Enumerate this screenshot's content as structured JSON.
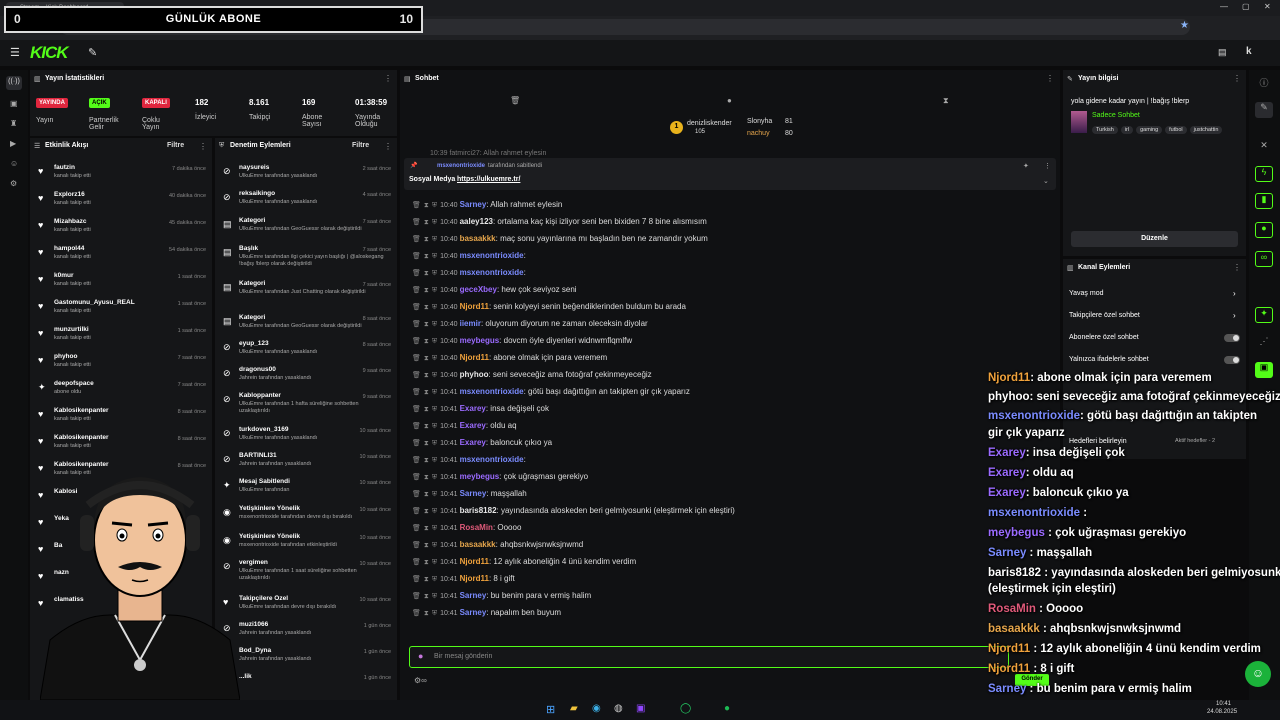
{
  "browser": {
    "tab_title": "Stream – Kick Dashboard",
    "url": "https://dashboard.kick.com/stream"
  },
  "overlay": {
    "left_count": "0",
    "label": "GÜNLÜK ABONE",
    "right_count": "10"
  },
  "logo": "KICK",
  "stats": {
    "title": "Yayın İstatistikleri",
    "yayinda_badge": "YAYINDA",
    "yayinda_label": "Yayın",
    "acik_badge": "AÇIK",
    "partner_label": "Partnerlik Gelir",
    "kapali_badge": "KAPALI",
    "coklu_label": "Çoklu Yayın",
    "viewers": "182",
    "viewers_label": "İzleyici",
    "followers": "8.161",
    "followers_label": "Takipçi",
    "subs": "169",
    "subs_label": "Abone Sayısı",
    "uptime": "01:38:59",
    "uptime_label": "Yayında Olduğu"
  },
  "activity": {
    "title": "Etkinlik Akışı",
    "filter": "Filtre",
    "items": [
      {
        "name": "fautzin",
        "desc": "kanalı takip etti",
        "time": "7 dakika önce"
      },
      {
        "name": "Explorz16",
        "desc": "kanalı takip etti",
        "time": "40 dakika önce"
      },
      {
        "name": "Mizahbazc",
        "desc": "kanalı takip etti",
        "time": "45 dakika önce"
      },
      {
        "name": "hampol44",
        "desc": "kanalı takip etti",
        "time": "54 dakika önce"
      },
      {
        "name": "k0mur",
        "desc": "kanalı takip etti",
        "time": "1 saat önce"
      },
      {
        "name": "Gastomunu_Ayusu_REAL",
        "desc": "kanalı takip etti",
        "time": "1 saat önce"
      },
      {
        "name": "munzurtilki",
        "desc": "kanalı takip etti",
        "time": "1 saat önce"
      },
      {
        "name": "phyhoo",
        "desc": "kanalı takip etti",
        "time": "7 saat önce"
      },
      {
        "name": "deepofspace",
        "desc": "abone oldu",
        "time": "7 saat önce"
      },
      {
        "name": "Kablosikenpanter",
        "desc": "kanalı takip etti",
        "time": "8 saat önce"
      },
      {
        "name": "Kablosikenpanter",
        "desc": "kanalı takip etti",
        "time": "8 saat önce"
      },
      {
        "name": "Kablosikenpanter",
        "desc": "kanalı takip etti",
        "time": "8 saat önce"
      },
      {
        "name": "Kablosi",
        "desc": "",
        "time": ""
      },
      {
        "name": "Yeka",
        "desc": "",
        "time": ""
      },
      {
        "name": "Ba",
        "desc": "",
        "time": ""
      },
      {
        "name": "nazn",
        "desc": "",
        "time": ""
      },
      {
        "name": "clamatiss",
        "desc": "",
        "time": ""
      }
    ]
  },
  "moderation": {
    "title": "Denetim Eylemleri",
    "filter": "Filtre",
    "items": [
      {
        "name": "naysureis",
        "desc": "UlkuEmre tarafından yasaklandı",
        "time": "2 saat önce"
      },
      {
        "name": "reksaikingo",
        "desc": "UlkuEmre tarafından yasaklandı",
        "time": "4 saat önce"
      },
      {
        "name": "Kategori",
        "desc": "UlkuEmre tarafından GeoGuessr olarak değiştirildi",
        "time": "7 saat önce"
      },
      {
        "name": "Başlık",
        "desc": "UlkuEmre tarafından ilgi çekici yayın başlığı | @aloskegang !bağış !blerp olarak değiştirildi",
        "time": "7 saat önce"
      },
      {
        "name": "Kategori",
        "desc": "UlkuEmre tarafından Just Chatting olarak değiştirildi",
        "time": "7 saat önce"
      },
      {
        "name": "Kategori",
        "desc": "UlkuEmre tarafından GeoGuessr olarak değiştirildi",
        "time": "8 saat önce"
      },
      {
        "name": "eyup_123",
        "desc": "UlkuEmre tarafından yasaklandı",
        "time": "8 saat önce"
      },
      {
        "name": "dragonus00",
        "desc": "Jahrein tarafından yasaklandı",
        "time": "9 saat önce"
      },
      {
        "name": "Kabloppanter",
        "desc": "UlkuEmre tarafından 1 hafta süreliğine sohbetten uzaklaştırıldı",
        "time": "9 saat önce"
      },
      {
        "name": "turkdoven_3169",
        "desc": "UlkuEmre tarafından yasaklandı",
        "time": "10 saat önce"
      },
      {
        "name": "BARTINLI31",
        "desc": "Jahrein tarafından yasaklandı",
        "time": "10 saat önce"
      },
      {
        "name": "Mesaj Sabitlendi",
        "desc": "UlkuEmre tarafından",
        "time": "10 saat önce"
      },
      {
        "name": "Yetişkinlere Yönelik",
        "desc": "msxenontrioxide tarafından devre dışı bırakıldı",
        "time": "10 saat önce"
      },
      {
        "name": "Yetişkinlere Yönelik",
        "desc": "msxenontrioxide tarafından etkinleştirildi",
        "time": "10 saat önce"
      },
      {
        "name": "vergimen",
        "desc": "UlkuEmre tarafından 1 saat süreliğine sohbetten uzaklaştırıldı",
        "time": "10 saat önce"
      },
      {
        "name": "Takipçilere Özel",
        "desc": "UlkuEmre tarafından devre dışı bırakıldı",
        "time": "10 saat önce"
      },
      {
        "name": "muzi1066",
        "desc": "Jahrein tarafından yasaklandı",
        "time": "1 gün önce"
      },
      {
        "name": "Bod_Dyna",
        "desc": "Jahrein tarafından yasaklandı",
        "time": "1 gün önce"
      },
      {
        "name": "...lik",
        "desc": "",
        "time": "1 gün önce"
      }
    ]
  },
  "chat": {
    "title": "Sohbet",
    "gift1_name": "denizliskender",
    "gift1_count": "105",
    "gift2_name": "Slonyha",
    "gift2_count": "81",
    "gift3_name": "nachuy",
    "gift3_count": "80",
    "pinned_by": "msxenontrioxide",
    "pinned_suffix": "tarafından sabitlendi",
    "pinned_text": "Sosyal Medya ",
    "pinned_link": "https://ulkuemre.tr/",
    "partial": "10:39  fatmirci27: Allah rahmet eylesin",
    "input_placeholder": "Bir mesaj gönderin",
    "send_label": "Gönder",
    "messages": [
      {
        "time": "10:40",
        "user": "Sarney",
        "color": "#7b8cff",
        "text": ": Allah rahmet eylesin"
      },
      {
        "time": "10:40",
        "user": "aaley123",
        "color": "#e8e8e8",
        "text": ": ortalama kaç kişi izliyor seni ben bixiden 7 8 bine alısmısım"
      },
      {
        "time": "10:40",
        "user": "basaakkk",
        "color": "#e6a64c",
        "text": ": maç sonu yayınlarına mı başladın ben ne zamandır yokum"
      },
      {
        "time": "10:40",
        "user": "msxenontrioxide",
        "color": "#7b8cff",
        "text": ":"
      },
      {
        "time": "10:40",
        "user": "msxenontrioxide",
        "color": "#7b8cff",
        "text": ":"
      },
      {
        "time": "10:40",
        "user": "geceXbey",
        "color": "#9b6bff",
        "text": ": hew çok seviyoz seni"
      },
      {
        "time": "10:40",
        "user": "Njord11",
        "color": "#f0a23c",
        "text": ": senin kolyeyi senin beğendiklerinden buldum bu arada"
      },
      {
        "time": "10:40",
        "user": "iiemir",
        "color": "#7b8cff",
        "text": ": oluyorum diyorum ne zaman oleceksin diyolar"
      },
      {
        "time": "10:40",
        "user": "meybegus",
        "color": "#9b6bff",
        "text": ": dovcm öyle diyenleri widnwmflqmlfw"
      },
      {
        "time": "10:40",
        "user": "Njord11",
        "color": "#f0a23c",
        "text": ": abone olmak için para veremem"
      },
      {
        "time": "10:40",
        "user": "phyhoo",
        "color": "#e8e8e8",
        "text": ": seni seveceğiz ama fotoğraf çekinmeyeceğiz"
      },
      {
        "time": "10:41",
        "user": "msxenontrioxide",
        "color": "#7b8cff",
        "text": ": götü başı dağıttığın an takipten gir çık yaparız"
      },
      {
        "time": "10:41",
        "user": "Exarey",
        "color": "#9b6bff",
        "text": ": insa değişeli çok"
      },
      {
        "time": "10:41",
        "user": "Exarey",
        "color": "#9b6bff",
        "text": ": oldu aq"
      },
      {
        "time": "10:41",
        "user": "Exarey",
        "color": "#9b6bff",
        "text": ": baloncuk çıkıo ya"
      },
      {
        "time": "10:41",
        "user": "msxenontrioxide",
        "color": "#7b8cff",
        "text": ":"
      },
      {
        "time": "10:41",
        "user": "meybegus",
        "color": "#9b6bff",
        "text": ": çok uğraşması gerekiyo"
      },
      {
        "time": "10:41",
        "user": "Sarney",
        "color": "#7b8cff",
        "text": ": maşşallah"
      },
      {
        "time": "10:41",
        "user": "baris8182",
        "color": "#e8e8e8",
        "text": ": yayındasında aloskeden beri gelmiyosunki (eleştirmek için eleştiri)"
      },
      {
        "time": "10:41",
        "user": "RosaMin",
        "color": "#e05a7a",
        "text": ": Ooooo"
      },
      {
        "time": "10:41",
        "user": "basaakkk",
        "color": "#e6a64c",
        "text": ": ahqbsnkwjsnwksjnwmd"
      },
      {
        "time": "10:41",
        "user": "Njord11",
        "color": "#f0a23c",
        "text": ": 12 aylık aboneliğin 4 ünü kendim verdim"
      },
      {
        "time": "10:41",
        "user": "Njord11",
        "color": "#f0a23c",
        "text": ": 8 i gift"
      },
      {
        "time": "10:41",
        "user": "Sarney",
        "color": "#7b8cff",
        "text": ": bu benim para v ermiş halim"
      },
      {
        "time": "10:41",
        "user": "Sarney",
        "color": "#7b8cff",
        "text": ": napalım ben buyum"
      }
    ]
  },
  "overlay_chat": [
    {
      "user": "Njord11",
      "color": "#f0a23c",
      "text": ": abone olmak için para veremem"
    },
    {
      "user": "phyhoo",
      "color": "#ffffff",
      "text": ": seni seveceğiz ama fotoğraf çekinmeyeceğiz"
    },
    {
      "user": "msxenontrioxide",
      "color": "#7b8cff",
      "text": ": götü başı dağıttığın an takipten"
    },
    {
      "user": "",
      "color": "#ffffff",
      "text": "gir çık yaparız"
    },
    {
      "user": "Exarey",
      "color": "#9b6bff",
      "text": ": insa değişeli çok"
    },
    {
      "user": "Exarey",
      "color": "#9b6bff",
      "text": ": oldu aq"
    },
    {
      "user": "Exarey",
      "color": "#9b6bff",
      "text": ": baloncuk çıkıo ya"
    },
    {
      "user": "msxenontrioxide",
      "color": "#7b8cff",
      "text": " :"
    },
    {
      "user": "meybegus",
      "color": "#9b6bff",
      "text": " : çok uğraşması gerekiyo"
    },
    {
      "user": "Sarney",
      "color": "#7b8cff",
      "text": " : maşşallah"
    },
    {
      "user": "baris8182",
      "color": "#ffffff",
      "text": " : yayındasında aloskeden beri gelmiyosunki"
    },
    {
      "user": "",
      "color": "#ffffff",
      "text": "(eleştirmek için eleştiri)"
    },
    {
      "user": "RosaMin",
      "color": "#e05a7a",
      "text": " : Ooooo"
    },
    {
      "user": "basaakkk",
      "color": "#e6a64c",
      "text": " : ahqbsnkwjsnwksjnwmd"
    },
    {
      "user": "Njord11",
      "color": "#f0a23c",
      "text": " : 12 aylık aboneliğin 4 ünü kendim verdim"
    },
    {
      "user": "Njord11",
      "color": "#f0a23c",
      "text": " : 8 i gift"
    },
    {
      "user": "Sarney",
      "color": "#7b8cff",
      "text": " : bu benim para v ermiş halim"
    },
    {
      "user": "Sarney",
      "color": "#7b8cff",
      "text": " : napalım ben buyum"
    }
  ],
  "stream_info": {
    "title": "Yayın bilgisi",
    "stream_title": "yola gidene kadar yayın | !bağış !blerp",
    "chat_mode": "Sadece Sohbet",
    "tags": [
      "Turkish",
      "irl",
      "gaming",
      "futbol",
      "justchattin"
    ],
    "edit": "Düzenle"
  },
  "channel_actions": {
    "title": "Kanal Eylemleri",
    "slow": "Yavaş mod",
    "followers_only": "Takipçilere özel sohbet",
    "subs_only": "Abonelere özel sohbet",
    "emotes_only": "Yalnızca ifadelerle sohbet",
    "goals": "Hedefleri belirleyin",
    "goals_status": "Aktif hedefler - 2"
  },
  "clock": {
    "time": "10:41",
    "date": "24.08.2025"
  }
}
